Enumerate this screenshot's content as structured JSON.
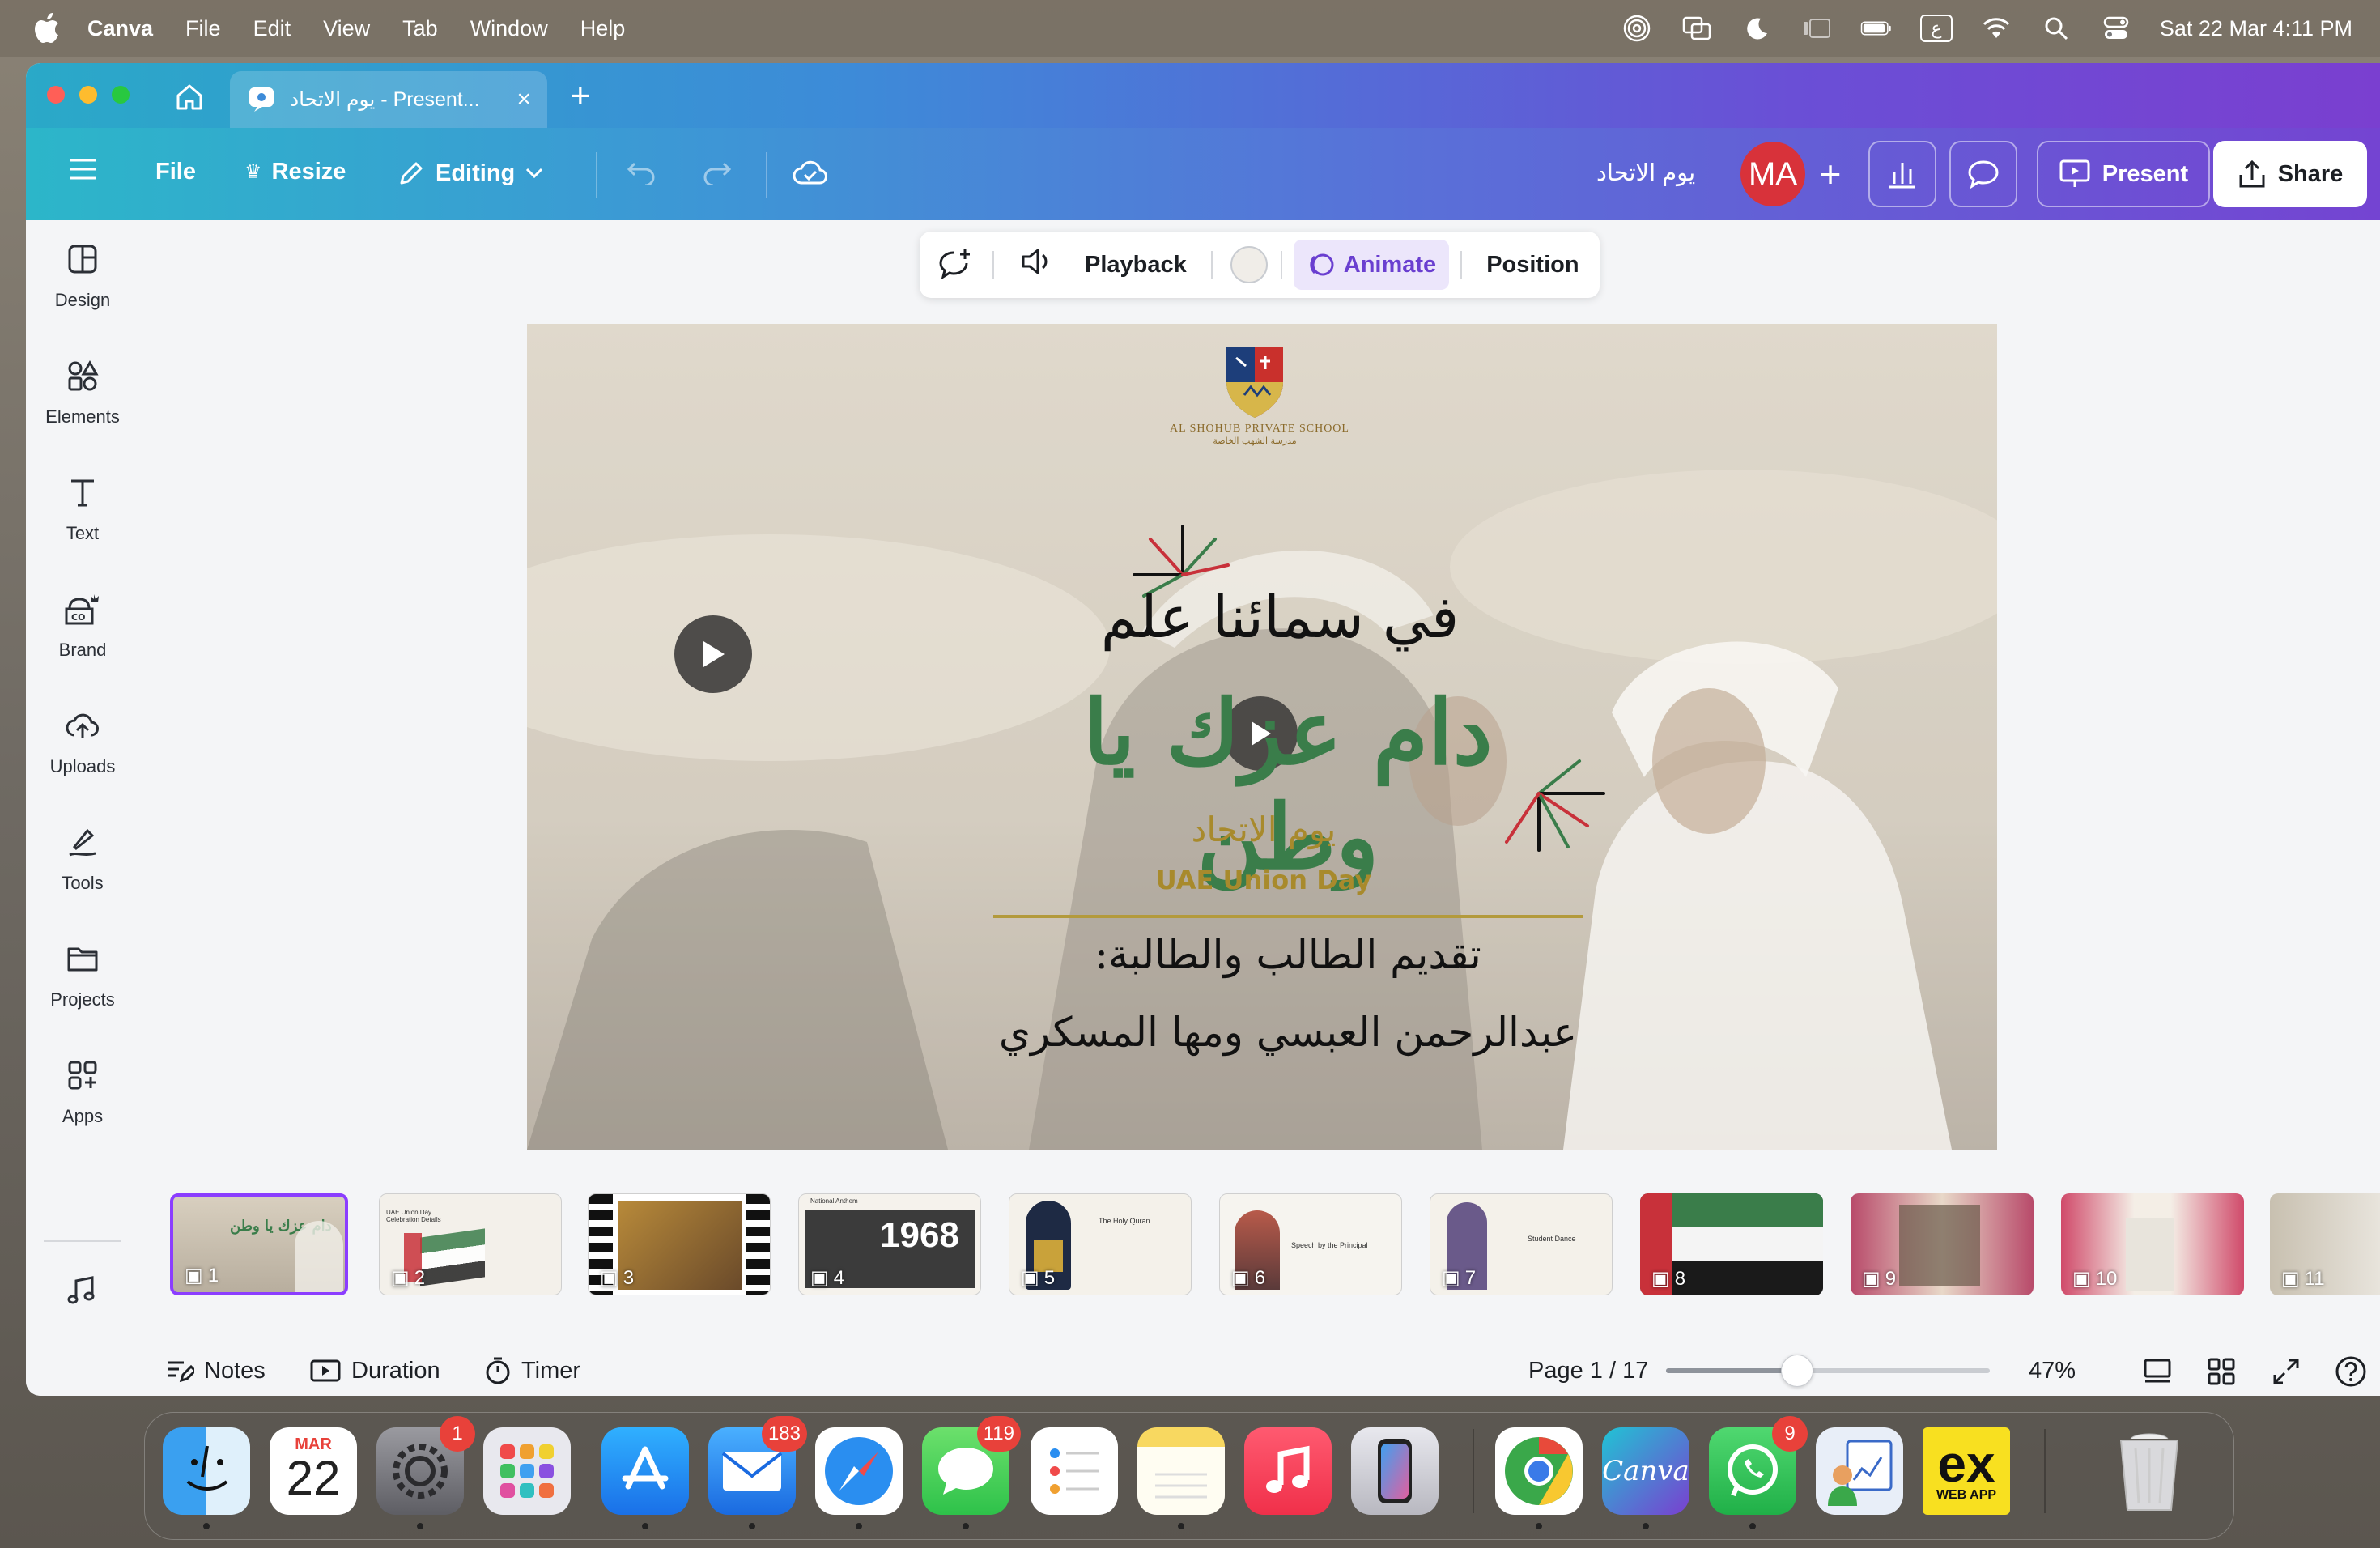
{
  "menubar": {
    "app": "Canva",
    "items": [
      "File",
      "Edit",
      "View",
      "Tab",
      "Window",
      "Help"
    ],
    "status": {
      "keyboard": "ع",
      "datetime": "Sat 22 Mar  4:11 PM"
    }
  },
  "browser_tab": {
    "title": "يوم الاتحاد - Present..."
  },
  "toolbar": {
    "file": "File",
    "resize": "Resize",
    "editing": "Editing",
    "doc_title": "يوم الاتحاد",
    "avatar": "MA",
    "present": "Present",
    "share": "Share"
  },
  "sidebar": {
    "items": [
      {
        "label": "Design",
        "icon": "layout-icon"
      },
      {
        "label": "Elements",
        "icon": "shapes-icon"
      },
      {
        "label": "Text",
        "icon": "text-icon"
      },
      {
        "label": "Brand",
        "icon": "brand-icon"
      },
      {
        "label": "Uploads",
        "icon": "cloud-upload-icon"
      },
      {
        "label": "Tools",
        "icon": "pen-tool-icon"
      },
      {
        "label": "Projects",
        "icon": "folder-icon"
      },
      {
        "label": "Apps",
        "icon": "apps-grid-icon"
      }
    ]
  },
  "context_bar": {
    "playback": "Playback",
    "animate": "Animate",
    "position": "Position"
  },
  "slide": {
    "school_name": "AL SHOHUB PRIVATE SCHOOL",
    "school_name_ar": "مدرسة الشهب الخاصة",
    "line1": "في سمائنا علم",
    "line2": "دام عزك يا وطن",
    "union_ar": "يوم الاتحاد",
    "union_en": "UAE Union Day",
    "presenter_label": "تقديم الطالب والطالبة:",
    "presenters": "عبدالرحمن العبسي ومها المسكري"
  },
  "filmstrip": {
    "thumbs": [
      {
        "n": "1"
      },
      {
        "n": "2"
      },
      {
        "n": "3"
      },
      {
        "n": "4"
      },
      {
        "n": "5"
      },
      {
        "n": "6"
      },
      {
        "n": "7"
      },
      {
        "n": "8"
      },
      {
        "n": "9"
      },
      {
        "n": "10"
      },
      {
        "n": "11"
      }
    ],
    "t4_year": "1968",
    "t4_head": "National Anthem",
    "t5_title": "The Holy Quran",
    "t6_title": "Speech by the Principal",
    "t7_title": "Student Dance",
    "t2_title": "UAE Union Day Celebration Details"
  },
  "footer": {
    "notes": "Notes",
    "duration": "Duration",
    "timer": "Timer",
    "page": "Page 1 / 17",
    "zoom": "47%",
    "zoom_fraction": 0.47
  },
  "dock": {
    "calendar_month": "MAR",
    "calendar_day": "22",
    "badges": {
      "settings": "1",
      "mail": "183",
      "messages": "119",
      "whatsapp": "9"
    },
    "canva_label": "Canva",
    "exapp_label": "ex",
    "exapp_sub": "WEB APP"
  },
  "colors": {
    "canva_purple": "#7a3fd0",
    "canva_teal": "#2cb6c9",
    "avatar_red": "#d8323a",
    "uae_green": "#3a7d4a",
    "uae_red": "#c8313a",
    "gold": "#a88a2c",
    "selected_outline": "#8b3dff"
  }
}
